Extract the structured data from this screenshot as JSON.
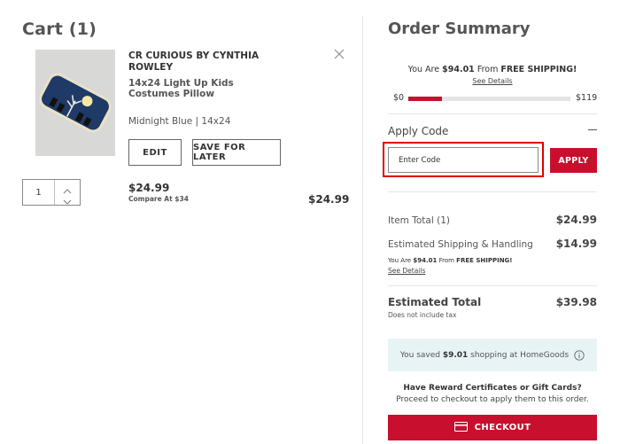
{
  "cart": {
    "title": "Cart (1)",
    "item": {
      "brand": "CR CURIOUS BY CYNTHIA ROWLEY",
      "name": "14x24 Light Up Kids Costumes Pillow",
      "variant": "Midnight Blue | 14x24",
      "edit_label": "EDIT",
      "save_label": "SAVE FOR LATER",
      "quantity": "1",
      "price": "$24.99",
      "compare": "Compare At $34",
      "line_total": "$24.99",
      "image_icon": "product-photo-pillow"
    }
  },
  "summary": {
    "title": "Order Summary",
    "free_shipping": {
      "prefix": "You Are ",
      "amount": "$94.01",
      "middle": " From ",
      "label": "FREE SHIPPING!",
      "see_details": "See Details",
      "min": "$0",
      "max": "$119",
      "progress": 0.21
    },
    "apply_code": {
      "label": "Apply Code",
      "placeholder": "Enter Code",
      "button": "APPLY"
    },
    "item_total_label": "Item Total (1)",
    "item_total_value": "$24.99",
    "shipping_label": "Estimated Shipping & Handling",
    "shipping_value": "$14.99",
    "shipping_note": {
      "prefix": "You Are ",
      "amount": "$94.01",
      "middle": " From ",
      "label": "FREE SHIPPING!"
    },
    "see_details": "See Details",
    "est_total_label": "Estimated Total",
    "est_total_value": "$39.98",
    "tax_note": "Does not include tax",
    "savings": {
      "prefix": "You saved ",
      "amount": "$9.01",
      "suffix": " shopping at HomeGoods"
    },
    "reward_title": "Have Reward Certificates or Gift Cards?",
    "reward_sub": "Proceed to checkout to apply them to this order.",
    "checkout_label": "CHECKOUT"
  },
  "colors": {
    "accent": "#c8102e",
    "savings_bg": "#e8f3f6",
    "highlight": "#dd0000"
  }
}
